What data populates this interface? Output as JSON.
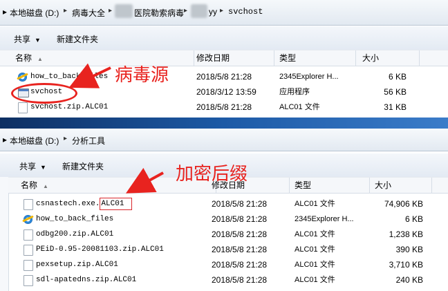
{
  "window_top": {
    "breadcrumb": {
      "segments": [
        "本地磁盘 (D:)",
        "病毒大全",
        "医院勒索病毒",
        "yy",
        "svchost"
      ]
    },
    "toolbar": {
      "share_label": "共享",
      "new_folder_label": "新建文件夹"
    },
    "columns": {
      "name": "名称",
      "date": "修改日期",
      "type": "类型",
      "size": "大小"
    },
    "files": [
      {
        "name": "how_to_back_files",
        "date": "2018/5/8 21:28",
        "type": "2345Explorer H...",
        "size": "6 KB",
        "icon": "browser-html-icon"
      },
      {
        "name": "svchost",
        "date": "2018/3/12 13:59",
        "type": "应用程序",
        "size": "56 KB",
        "icon": "application-exe-icon"
      },
      {
        "name": "svchost.zip.ALC01",
        "date": "2018/5/8 21:28",
        "type": "ALC01 文件",
        "size": "31 KB",
        "icon": "generic-file-icon"
      }
    ]
  },
  "window_bottom": {
    "breadcrumb": {
      "segments": [
        "本地磁盘 (D:)",
        "分析工具"
      ]
    },
    "toolbar": {
      "share_label": "共享",
      "new_folder_label": "新建文件夹"
    },
    "columns": {
      "name": "名称",
      "date": "修改日期",
      "type": "类型",
      "size": "大小"
    },
    "files": [
      {
        "name_prefix": "csnastech.exe.",
        "name_ext": "ALC01",
        "date": "2018/5/8 21:28",
        "type": "ALC01 文件",
        "size": "74,906 KB",
        "icon": "generic-file-icon"
      },
      {
        "name": "how_to_back_files",
        "date": "2018/5/8 21:28",
        "type": "2345Explorer H...",
        "size": "6 KB",
        "icon": "browser-html-icon"
      },
      {
        "name": "odbg200.zip.ALC01",
        "date": "2018/5/8 21:28",
        "type": "ALC01 文件",
        "size": "1,238 KB",
        "icon": "generic-file-icon"
      },
      {
        "name": "PEiD-0.95-20081103.zip.ALC01",
        "date": "2018/5/8 21:28",
        "type": "ALC01 文件",
        "size": "390 KB",
        "icon": "generic-file-icon"
      },
      {
        "name": "pexsetup.zip.ALC01",
        "date": "2018/5/8 21:28",
        "type": "ALC01 文件",
        "size": "3,710 KB",
        "icon": "generic-file-icon"
      },
      {
        "name": "sdl-apatedns.zip.ALC01",
        "date": "2018/5/8 21:28",
        "type": "ALC01 文件",
        "size": "240 KB",
        "icon": "generic-file-icon"
      }
    ]
  },
  "annotations": {
    "virus_source": "病毒源",
    "encrypted_suffix": "加密后缀",
    "color": "#e8231f"
  }
}
